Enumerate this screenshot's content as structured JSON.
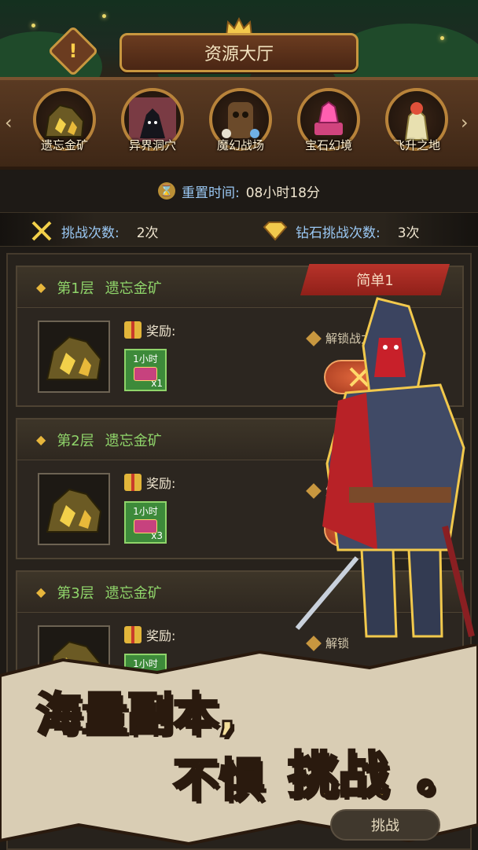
{
  "header": {
    "title": "资源大厅",
    "alert_icon": "!"
  },
  "categories": [
    {
      "label": "遗忘金矿",
      "icon": "gold-ore-icon"
    },
    {
      "label": "异界洞穴",
      "icon": "cave-icon"
    },
    {
      "label": "魔幻战场",
      "icon": "battlefield-icon"
    },
    {
      "label": "宝石幻境",
      "icon": "gem-icon"
    },
    {
      "label": "飞升之地",
      "icon": "ascension-icon"
    }
  ],
  "reset": {
    "label": "重置时间:",
    "value": "08小时18分"
  },
  "counts": {
    "challenge_label": "挑战次数:",
    "challenge_value": "2次",
    "diamond_label": "钻石挑战次数:",
    "diamond_value": "3次"
  },
  "difficulty": "简单1",
  "floors": [
    {
      "title": "第1层",
      "name": "遗忘金矿",
      "reward_label": "奖励:",
      "chest_time": "1小时",
      "chest_qty": "x1",
      "unlock": "解锁战力"
    },
    {
      "title": "第2层",
      "name": "遗忘金矿",
      "reward_label": "奖励:",
      "chest_time": "1小时",
      "chest_qty": "x3",
      "unlock": "解"
    },
    {
      "title": "第3层",
      "name": "遗忘金矿",
      "reward_label": "奖励:",
      "chest_time": "1小时",
      "chest_qty": "",
      "unlock": "解锁"
    }
  ],
  "banner": {
    "line1": "海量副本,",
    "line2a": "不惧",
    "line2b": "挑战",
    "line2c": "。"
  },
  "bottom_button": "挑战",
  "colors": {
    "accent_gold": "#c8973f",
    "ribbon_red": "#b8332a",
    "floor_green": "#8fd46a",
    "label_blue": "#9bc9f5"
  }
}
